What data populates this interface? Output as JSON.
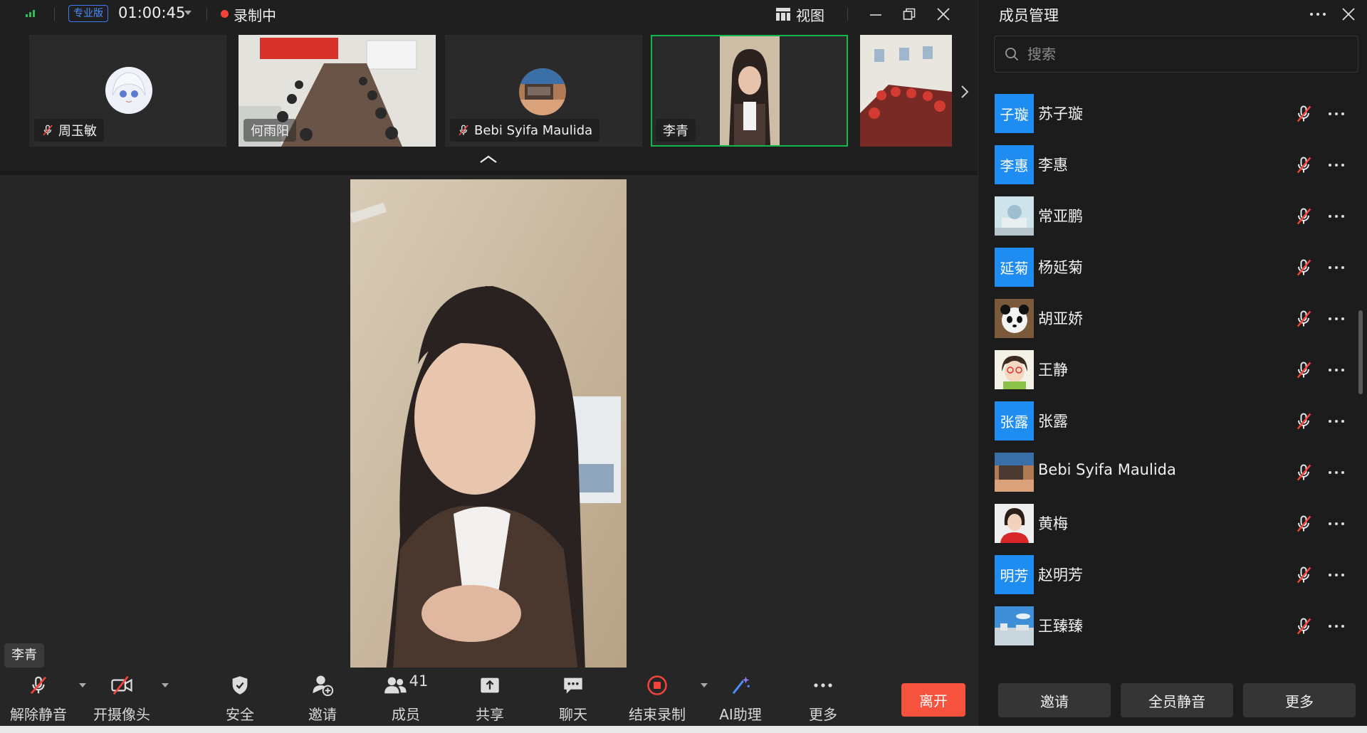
{
  "topbar": {
    "edition": "专业版",
    "timer": "01:00:45",
    "recording": "录制中",
    "view": "视图"
  },
  "thumbnails": [
    {
      "name": "周玉敏",
      "muted": true
    },
    {
      "name": "何雨阳",
      "muted": false
    },
    {
      "name": "Bebi Syifa Maulida",
      "muted": true
    },
    {
      "name": "李青",
      "muted": false,
      "active": true
    },
    {
      "name": "",
      "muted": false
    }
  ],
  "stage": {
    "speaker": "李青"
  },
  "toolbar": {
    "unmute": "解除静音",
    "camera": "开摄像头",
    "security": "安全",
    "invite": "邀请",
    "members": "成员",
    "member_count": "41",
    "share": "共享",
    "chat": "聊天",
    "stop_record": "结束录制",
    "ai": "AI助理",
    "more": "更多",
    "leave": "离开"
  },
  "panel": {
    "title": "成员管理",
    "search_placeholder": "搜索",
    "members": [
      {
        "name": "苏子璇",
        "avatar_text": "子璇",
        "avatar": "blue"
      },
      {
        "name": "李惠",
        "avatar_text": "李惠",
        "avatar": "blue"
      },
      {
        "name": "常亚鹏",
        "avatar_text": "",
        "avatar": "photo-toy"
      },
      {
        "name": "杨延菊",
        "avatar_text": "延菊",
        "avatar": "blue"
      },
      {
        "name": "胡亚娇",
        "avatar_text": "",
        "avatar": "photo-panda"
      },
      {
        "name": "王静",
        "avatar_text": "",
        "avatar": "photo-cartoon"
      },
      {
        "name": "张露",
        "avatar_text": "张露",
        "avatar": "blue"
      },
      {
        "name": "Bebi Syifa Maulida",
        "avatar_text": "",
        "avatar": "photo-desk"
      },
      {
        "name": "黄梅",
        "avatar_text": "",
        "avatar": "photo-woman"
      },
      {
        "name": "赵明芳",
        "avatar_text": "明芳",
        "avatar": "blue"
      },
      {
        "name": "王臻臻",
        "avatar_text": "",
        "avatar": "photo-sky"
      }
    ],
    "invite": "邀请",
    "mute_all": "全员静音",
    "more": "更多"
  },
  "colors": {
    "accent_green": "#14b84a",
    "leave_red": "#f5533d",
    "record_red": "#f5433b",
    "avatar_blue": "#1e8cf0"
  }
}
